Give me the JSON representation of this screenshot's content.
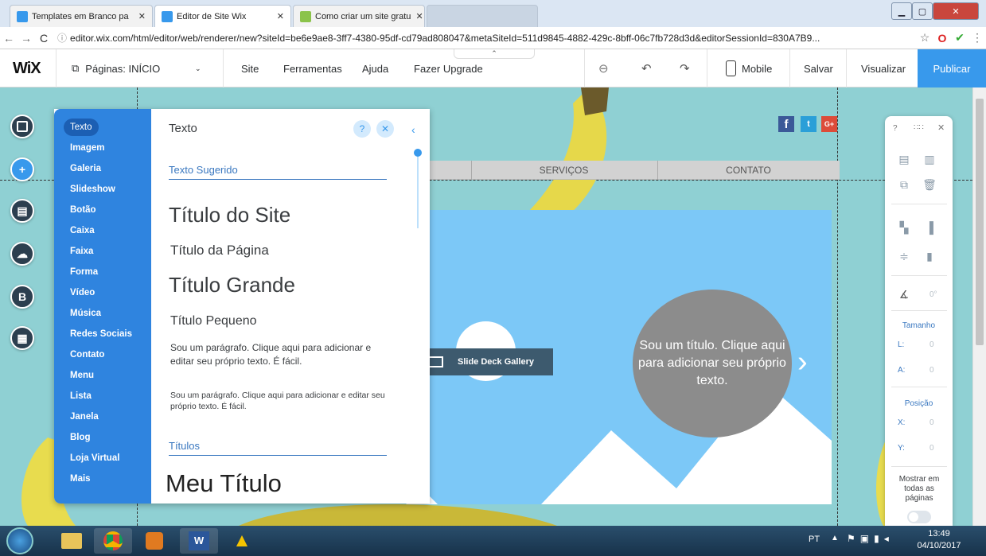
{
  "browser": {
    "tabs": [
      {
        "title": "Templates em Branco pa"
      },
      {
        "title": "Editor de Site Wix"
      },
      {
        "title": "Como criar um site gratu"
      }
    ],
    "url": "editor.wix.com/html/editor/web/renderer/new?siteId=be6e9ae8-3ff7-4380-95df-cd79ad808047&metaSiteId=511d9845-4882-429c-8bff-06c7fb728d3d&editorSessionId=830A7B9..."
  },
  "topbar": {
    "logo": "WiX",
    "pages_label": "Páginas: INÍCIO",
    "menu": [
      "Site",
      "Ferramentas",
      "Ajuda",
      "Fazer Upgrade"
    ],
    "mobile": "Mobile",
    "save": "Salvar",
    "preview": "Visualizar",
    "publish": "Publicar"
  },
  "left_tools": [
    "background-icon",
    "add-icon",
    "app-market-icon",
    "upload-icon",
    "blog-icon",
    "bookings-icon"
  ],
  "add_panel": {
    "categories": [
      "Texto",
      "Imagem",
      "Galeria",
      "Slideshow",
      "Botão",
      "Caixa",
      "Faixa",
      "Forma",
      "Vídeo",
      "Música",
      "Redes Sociais",
      "Contato",
      "Menu",
      "Lista",
      "Janela",
      "Blog",
      "Loja Virtual",
      "Mais"
    ],
    "title": "Texto",
    "help": "?",
    "section1": "Texto Sugerido",
    "site_title": "Título do Site",
    "page_title": "Título da Página",
    "big_title": "Título Grande",
    "small_title": "Título Pequeno",
    "para1": "Sou um parágrafo. Clique aqui para adicionar e editar seu próprio texto. É fácil.",
    "para2": "Sou um parágrafo. Clique aqui para adicionar e editar seu próprio texto. É fácil.",
    "section2": "Títulos",
    "my_title": "Meu Título"
  },
  "site": {
    "nav": [
      "SERVIÇOS",
      "CONTATO"
    ],
    "social": [
      "f",
      "t",
      "G+"
    ],
    "gallery_label": "Slide Deck Gallery",
    "circle_text": "Sou um título. Clique aqui para adicionar seu próprio texto."
  },
  "right_panel": {
    "help": "?",
    "angle": "0°",
    "size_label": "Tamanho",
    "w_label": "L:",
    "w_val": "0",
    "h_label": "A:",
    "h_val": "0",
    "pos_label": "Posição",
    "x_label": "X:",
    "x_val": "0",
    "y_label": "Y:",
    "y_val": "0",
    "show_all": "Mostrar em todas as páginas"
  },
  "taskbar": {
    "lang": "PT",
    "time": "13:49",
    "date": "04/10/2017"
  },
  "colors": {
    "accent": "#3899ec",
    "panel_blue": "#2f84df",
    "stage": "#8fd0d3",
    "hero": "#7cc8f7"
  }
}
